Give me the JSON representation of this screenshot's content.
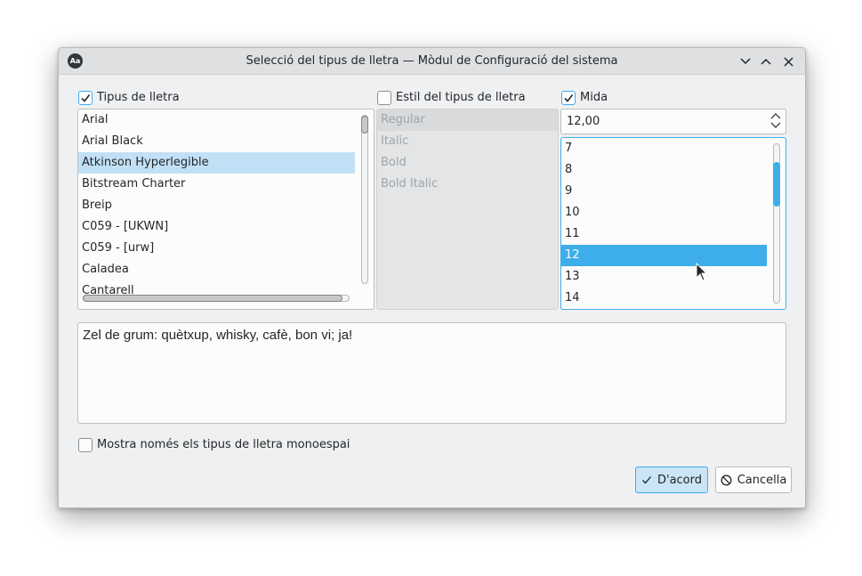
{
  "window": {
    "title": "Selecció del tipus de lletra — Mòdul de Configuració del sistema",
    "app_icon_text": "Aa"
  },
  "font_family": {
    "label": "Tipus de lletra",
    "checked": true,
    "items": [
      "Arial",
      "Arial Black",
      "Atkinson Hyperlegible",
      "Bitstream Charter",
      "Breip",
      "C059 - [UKWN]",
      "C059 - [urw]",
      "Caladea",
      "Cantarell"
    ],
    "selected": "Atkinson Hyperlegible"
  },
  "font_style": {
    "label": "Estil del tipus de lletra",
    "checked": false,
    "items": [
      "Regular",
      "Italic",
      "Bold",
      "Bold Italic"
    ]
  },
  "size": {
    "label": "Mida",
    "checked": true,
    "value": "12,00",
    "items": [
      "7",
      "8",
      "9",
      "10",
      "11",
      "12",
      "13",
      "14"
    ],
    "selected": "12"
  },
  "preview": {
    "text": "Zel de grum: quètxup, whisky, cafè, bon vi; ja!"
  },
  "monospace_only": {
    "label": "Mostra només els tipus de lletra monoespai",
    "checked": false
  },
  "buttons": {
    "ok_label": "D'acord",
    "cancel_label": "Cancella"
  },
  "colors": {
    "accent": "#3daee9",
    "selection_light": "#c2e0f5",
    "window_bg": "#eff0f1"
  }
}
